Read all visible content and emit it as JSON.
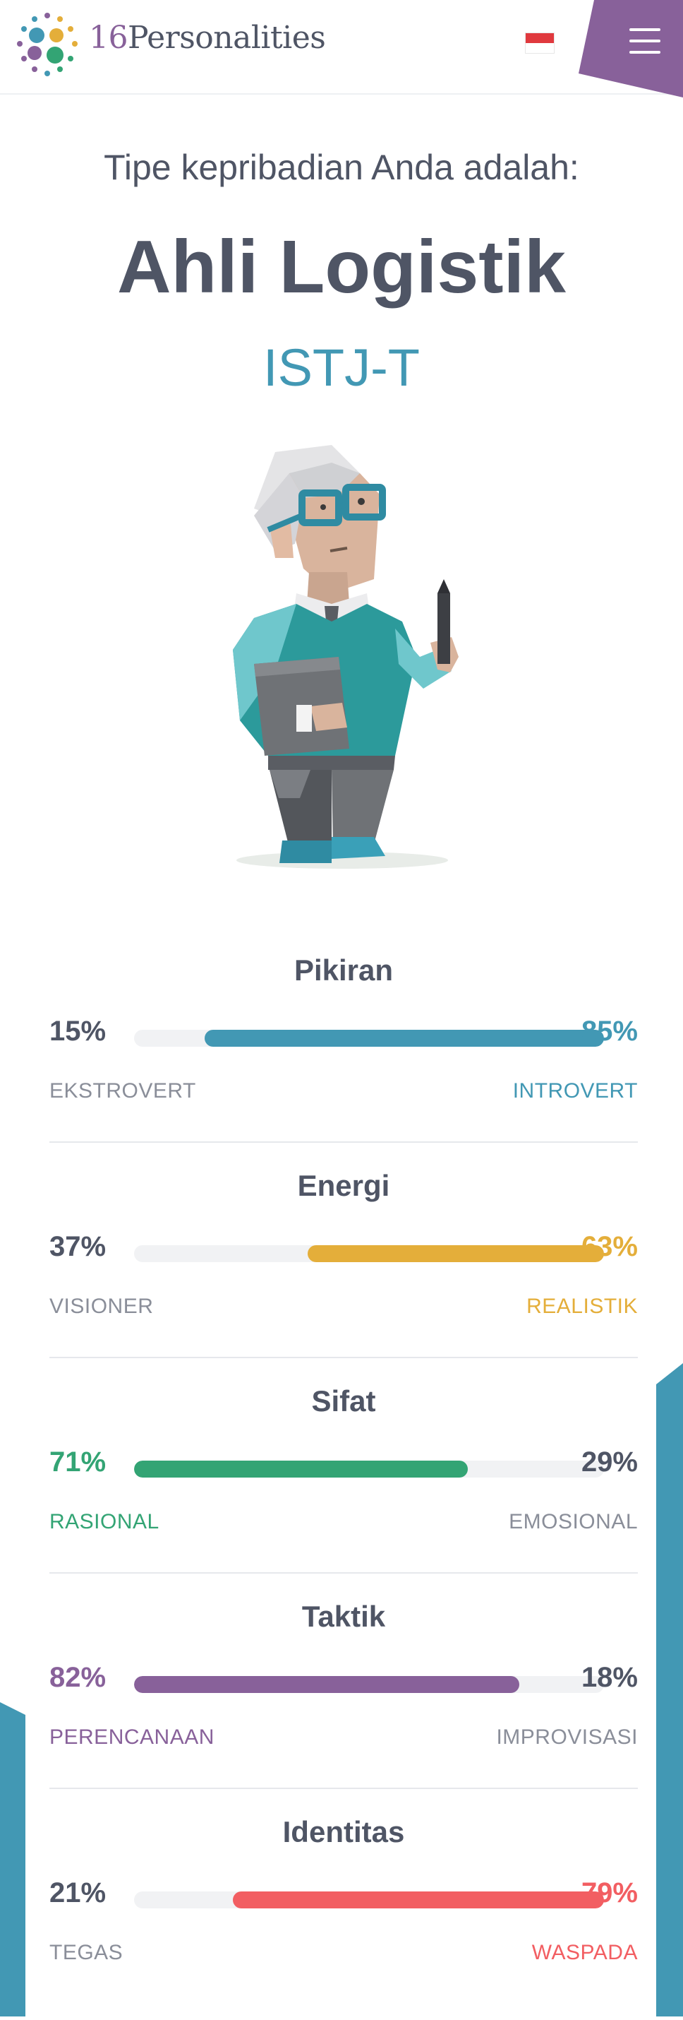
{
  "header": {
    "logo_number": "16",
    "logo_word": "Personalities",
    "logo_icon": "dots-logo-icon",
    "language_flag": "indonesia-flag-icon",
    "menu_icon": "hamburger-menu-icon"
  },
  "hero": {
    "intro": "Tipe kepribadian Anda adalah:",
    "type_name": "Ahli Logistik",
    "type_code": "ISTJ-T",
    "avatar_icon": "logistician-character-illustration"
  },
  "colors": {
    "mind": "#4298b4",
    "energy": "#e4ae3a",
    "nature": "#33a474",
    "tactics": "#88619a",
    "identity": "#f25e62",
    "text": "#4f5565",
    "muted": "#8a8e99"
  },
  "traits": [
    {
      "title": "Pikiran",
      "left_pct": "15%",
      "right_pct": "85%",
      "left_label": "EKSTROVERT",
      "right_label": "INTROVERT",
      "left_value": 15,
      "dominant": "right",
      "color": "#4298b4"
    },
    {
      "title": "Energi",
      "left_pct": "37%",
      "right_pct": "63%",
      "left_label": "VISIONER",
      "right_label": "REALISTIK",
      "left_value": 37,
      "dominant": "right",
      "color": "#e4ae3a"
    },
    {
      "title": "Sifat",
      "left_pct": "71%",
      "right_pct": "29%",
      "left_label": "RASIONAL",
      "right_label": "EMOSIONAL",
      "left_value": 71,
      "dominant": "left",
      "color": "#33a474"
    },
    {
      "title": "Taktik",
      "left_pct": "82%",
      "right_pct": "18%",
      "left_label": "PERENCANAAN",
      "right_label": "IMPROVISASI",
      "left_value": 82,
      "dominant": "left",
      "color": "#88619a"
    },
    {
      "title": "Identitas",
      "left_pct": "21%",
      "right_pct": "79%",
      "left_label": "TEGAS",
      "right_label": "WASPADA",
      "left_value": 21,
      "dominant": "right",
      "color": "#f25e62"
    }
  ]
}
